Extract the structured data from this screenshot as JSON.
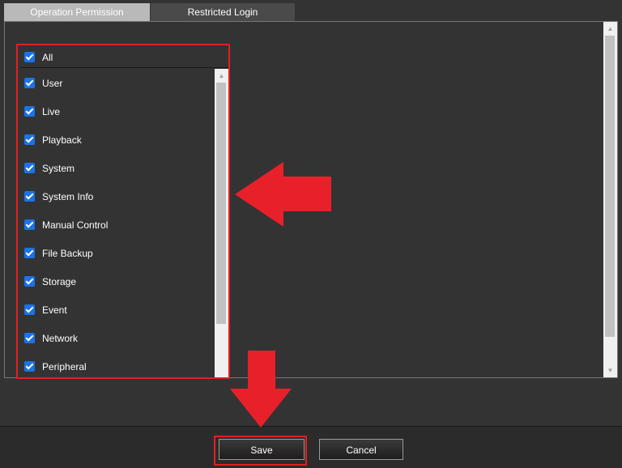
{
  "tabs": [
    {
      "label": "Operation Permission",
      "active": true
    },
    {
      "label": "Restricted Login",
      "active": false
    }
  ],
  "permissions": {
    "all": {
      "label": "All",
      "checked": true
    },
    "items": [
      {
        "label": "User",
        "checked": true
      },
      {
        "label": "Live",
        "checked": true
      },
      {
        "label": "Playback",
        "checked": true
      },
      {
        "label": "System",
        "checked": true
      },
      {
        "label": "System Info",
        "checked": true
      },
      {
        "label": "Manual Control",
        "checked": true
      },
      {
        "label": "File Backup",
        "checked": true
      },
      {
        "label": "Storage",
        "checked": true
      },
      {
        "label": "Event",
        "checked": true
      },
      {
        "label": "Network",
        "checked": true
      },
      {
        "label": "Peripheral",
        "checked": true
      }
    ]
  },
  "footer": {
    "save_label": "Save",
    "cancel_label": "Cancel"
  },
  "colors": {
    "background": "#333333",
    "checkbox": "#1a73e8",
    "highlight": "#e02020",
    "annotation_arrow": "#e8202a"
  },
  "icons": {
    "check": "checkmark-icon",
    "scroll_up": "scroll-up-arrow-icon",
    "scroll_down": "scroll-down-arrow-icon",
    "annotation_left": "arrow-left-icon",
    "annotation_down": "arrow-down-icon"
  }
}
